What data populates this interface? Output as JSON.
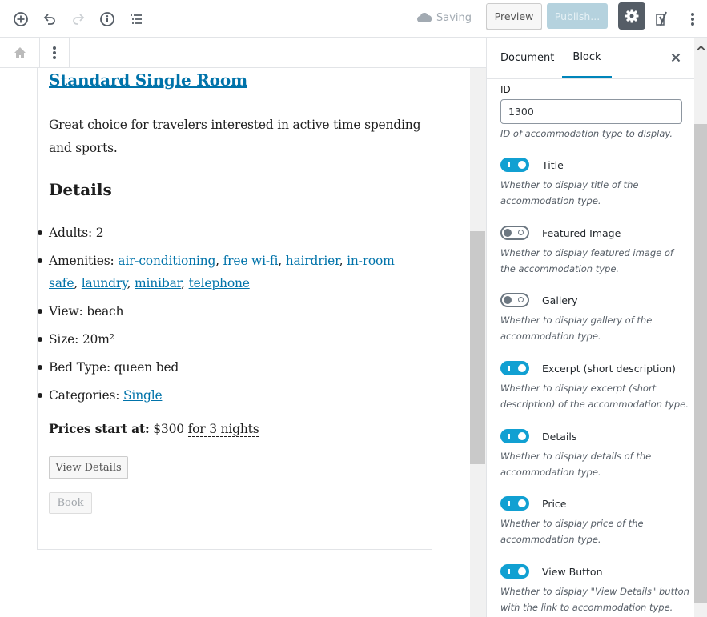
{
  "topbar": {
    "saving_label": "Saving",
    "preview_label": "Preview",
    "publish_label": "Publish...",
    "icons": [
      "add-block-icon",
      "undo-icon",
      "redo-icon",
      "info-icon",
      "outline-icon",
      "cloud-icon",
      "gear-icon",
      "yoast-icon",
      "more-vertical-icon"
    ]
  },
  "block_toolbar": {
    "icons": [
      "home-icon",
      "more-vertical-icon"
    ]
  },
  "content": {
    "title": "Standard Single Room",
    "excerpt": "Great choice for travelers interested in active time spending and sports.",
    "details_heading": "Details",
    "adults_label": "Adults:",
    "adults_value": "2",
    "amenities_label": "Amenities:",
    "amenities": [
      "air-conditioning",
      "free wi-fi",
      "hairdrier",
      "in-room safe",
      "laundry",
      "minibar",
      "telephone"
    ],
    "view_label": "View:",
    "view_value": "beach",
    "size_label": "Size:",
    "size_value": "20m²",
    "bed_label": "Bed Type:",
    "bed_value": "queen bed",
    "categories_label": "Categories:",
    "categories": [
      "Single"
    ],
    "price_label": "Prices start at:",
    "price_value": "$300",
    "price_period": "for 3 nights",
    "view_details_button": "View Details",
    "book_button": "Book"
  },
  "sidebar": {
    "tabs": [
      {
        "label": "Document",
        "active": false
      },
      {
        "label": "Block",
        "active": true
      }
    ],
    "id_field": {
      "label": "ID",
      "value": "1300",
      "help": "ID of accommodation type to display."
    },
    "toggles": [
      {
        "label": "Title",
        "on": true,
        "help": "Whether to display title of the accommodation type."
      },
      {
        "label": "Featured Image",
        "on": false,
        "help": "Whether to display featured image of the accommodation type."
      },
      {
        "label": "Gallery",
        "on": false,
        "help": "Whether to display gallery of the accommodation type."
      },
      {
        "label": "Excerpt (short description)",
        "on": true,
        "help": "Whether to display excerpt (short description) of the accommodation type."
      },
      {
        "label": "Details",
        "on": true,
        "help": "Whether to display details of the accommodation type."
      },
      {
        "label": "Price",
        "on": true,
        "help": "Whether to display price of the accommodation type."
      },
      {
        "label": "View Button",
        "on": true,
        "help": "Whether to display \"View Details\" button with the link to accommodation type."
      }
    ]
  },
  "colors": {
    "accent": "#0085ba",
    "link": "#0073aa",
    "toggle_on": "#11a0d2",
    "settings_bg": "#555d66",
    "publish_disabled": "#b5d2de"
  }
}
